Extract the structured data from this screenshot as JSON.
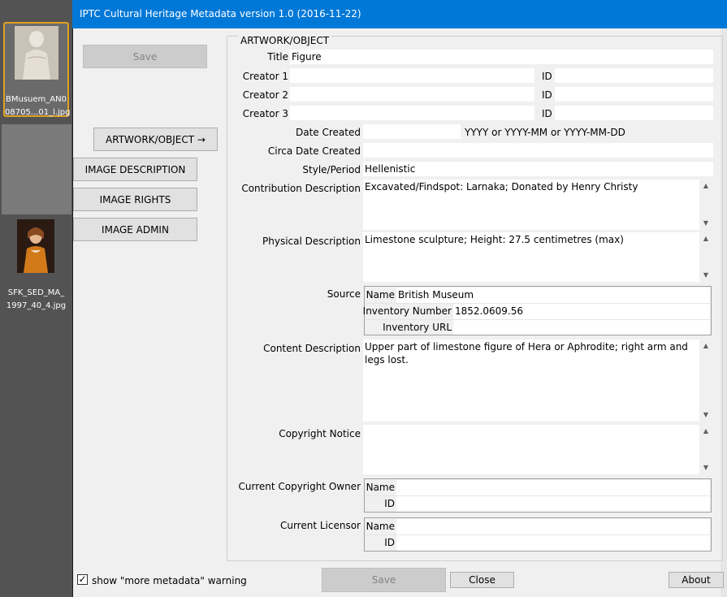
{
  "dialog": {
    "title": "IPTC Cultural Heritage Metadata  version 1.0 (2016-11-22)"
  },
  "filmstrip": {
    "items": [
      {
        "label": "BMusuem_AN0\n08705...01_l.jpg",
        "selected": true
      },
      {
        "label": "",
        "selected": false
      },
      {
        "label": "SFK_SED_MA_\n1997_40_4.jpg",
        "selected": false
      }
    ]
  },
  "nav": {
    "save_top": "Save",
    "artwork": "ARTWORK/OBJECT →",
    "image_description": "IMAGE DESCRIPTION",
    "image_rights": "IMAGE RIGHTS",
    "image_admin": "IMAGE ADMIN"
  },
  "group_title": "ARTWORK/OBJECT",
  "labels": {
    "title": "Title",
    "creator1": "Creator 1",
    "creator2": "Creator 2",
    "creator3": "Creator 3",
    "id": "ID",
    "date_created": "Date Created",
    "date_hint": "YYYY or YYYY-MM or YYYY-MM-DD",
    "circa_date_created": "Circa Date Created",
    "style_period": "Style/Period",
    "contribution_description": "Contribution Description",
    "physical_description": "Physical Description",
    "source": "Source",
    "source_name": "Name",
    "inventory_number": "Inventory Number",
    "inventory_url": "Inventory URL",
    "content_description": "Content Description",
    "copyright_notice": "Copyright Notice",
    "current_copyright_owner": "Current Copyright Owner",
    "current_licensor": "Current Licensor",
    "name": "Name",
    "id_short": "ID"
  },
  "values": {
    "title": "Figure",
    "creator1": "",
    "creator1_id": "",
    "creator2": "",
    "creator2_id": "",
    "creator3": "",
    "creator3_id": "",
    "date_created": "",
    "circa_date_created": "",
    "style_period": "Hellenistic",
    "contribution_description": "Excavated/Findspot: Larnaka; Donated by Henry Christy",
    "physical_description": "Limestone sculpture; Height: 27.5 centimetres (max)",
    "source_name": "British Museum",
    "inventory_number": "1852.0609.56",
    "inventory_url": "",
    "content_description": "Upper part of limestone figure of Hera or Aphrodite; right arm and legs lost.",
    "copyright_notice": "",
    "copyright_owner_name": "",
    "copyright_owner_id": "",
    "licensor_name": "",
    "licensor_id": ""
  },
  "footer": {
    "checkbox_label": "show \"more metadata\" warning",
    "checkbox_checked": "✓",
    "save": "Save",
    "close": "Close",
    "about": "About"
  },
  "scroll_glyphs": {
    "up": "▲",
    "down": "▼"
  }
}
